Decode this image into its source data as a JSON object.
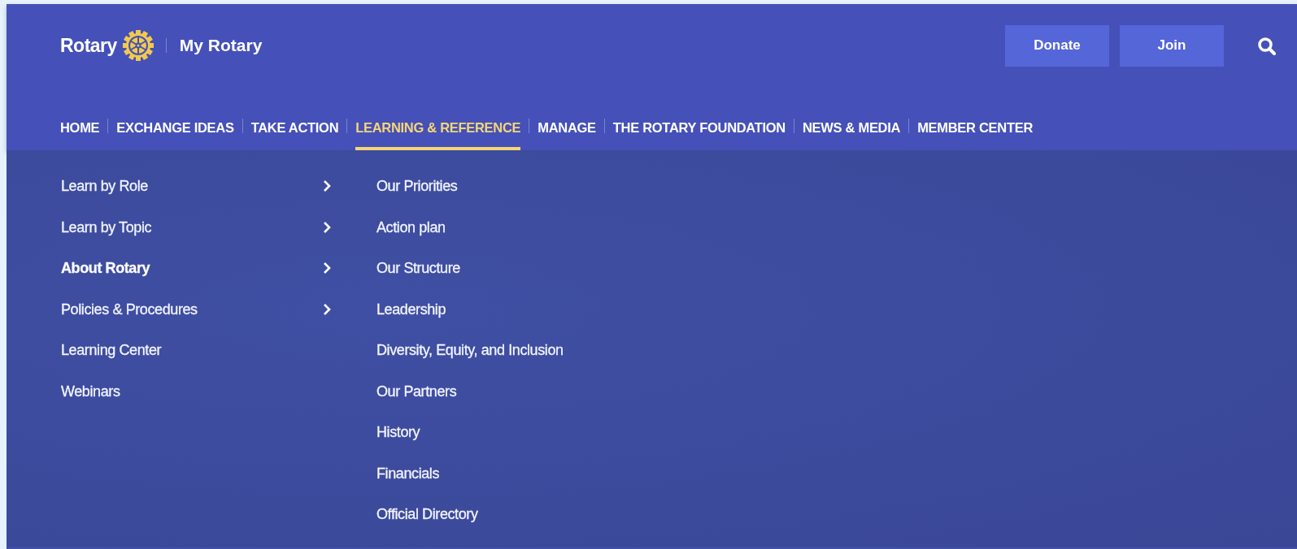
{
  "brand": {
    "logo_text": "Rotary",
    "site_name": "My Rotary"
  },
  "actions": [
    {
      "label": "Donate"
    },
    {
      "label": "Join"
    }
  ],
  "nav": [
    {
      "label": "HOME",
      "selected": false
    },
    {
      "label": "EXCHANGE IDEAS",
      "selected": false
    },
    {
      "label": "TAKE ACTION",
      "selected": false
    },
    {
      "label": "LEARNING & REFERENCE",
      "selected": true
    },
    {
      "label": "MANAGE",
      "selected": false
    },
    {
      "label": "THE ROTARY FOUNDATION",
      "selected": false
    },
    {
      "label": "NEWS & MEDIA",
      "selected": false
    },
    {
      "label": "MEMBER CENTER",
      "selected": false
    }
  ],
  "menu": [
    {
      "label": "Learn by Role",
      "submenu": true,
      "selected": false
    },
    {
      "label": "Learn by Topic",
      "submenu": true,
      "selected": false
    },
    {
      "label": "About Rotary",
      "submenu": true,
      "selected": true
    },
    {
      "label": "Policies & Procedures",
      "submenu": true,
      "selected": false
    },
    {
      "label": "Learning Center",
      "submenu": false,
      "selected": false
    },
    {
      "label": "Webinars",
      "submenu": false,
      "selected": false
    }
  ],
  "submenu": [
    {
      "label": "Our Priorities"
    },
    {
      "label": "Action plan"
    },
    {
      "label": "Our Structure"
    },
    {
      "label": "Leadership"
    },
    {
      "label": "Diversity, Equity, and Inclusion"
    },
    {
      "label": "Our Partners"
    },
    {
      "label": "History"
    },
    {
      "label": "Financials"
    },
    {
      "label": "Official Directory"
    }
  ]
}
